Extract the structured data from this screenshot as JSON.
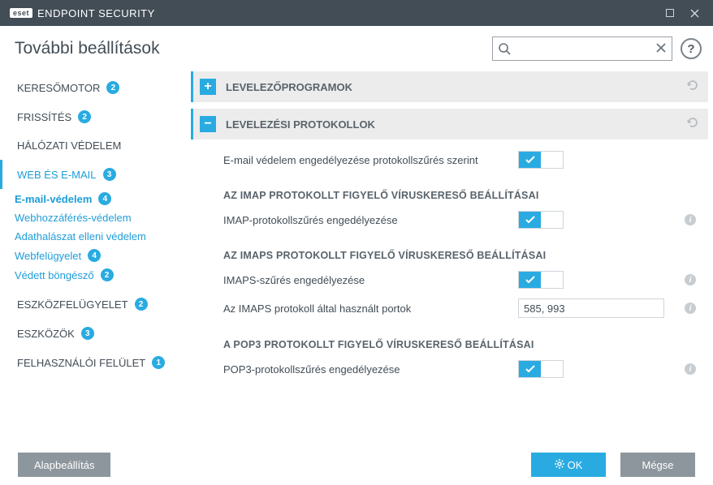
{
  "titlebar": {
    "brand_badge": "eset",
    "brand_text": "ENDPOINT SECURITY"
  },
  "header": {
    "title": "További beállítások",
    "search_placeholder": "",
    "help_label": "?"
  },
  "sidebar": {
    "items": [
      {
        "label": "KERESŐMOTOR",
        "badge": "2"
      },
      {
        "label": "FRISSÍTÉS",
        "badge": "2"
      },
      {
        "label": "HÁLÓZATI VÉDELEM",
        "badge": ""
      },
      {
        "label": "WEB ÉS E-MAIL",
        "badge": "3"
      },
      {
        "label": "ESZKÖZFELÜGYELET",
        "badge": "2"
      },
      {
        "label": "ESZKÖZÖK",
        "badge": "3"
      },
      {
        "label": "FELHASZNÁLÓI FELÜLET",
        "badge": "1"
      }
    ],
    "subitems": [
      {
        "label": "E-mail-védelem",
        "badge": "4"
      },
      {
        "label": "Webhozzáférés-védelem",
        "badge": ""
      },
      {
        "label": "Adathalászat elleni védelem",
        "badge": ""
      },
      {
        "label": "Webfelügyelet",
        "badge": "4"
      },
      {
        "label": "Védett böngésző",
        "badge": "2"
      }
    ]
  },
  "sections": {
    "mail_clients": {
      "title": "LEVELEZŐPROGRAMOK"
    },
    "mail_protocols": {
      "title": "LEVELEZÉSI PROTOKOLLOK",
      "enable_label": "E-mail védelem engedélyezése protokollszűrés szerint",
      "imap_head": "AZ IMAP PROTOKOLLT FIGYELŐ VÍRUSKERESŐ BEÁLLÍTÁSAI",
      "imap_enable": "IMAP-protokollszűrés engedélyezése",
      "imaps_head": "AZ IMAPS PROTOKOLLT FIGYELŐ VÍRUSKERESŐ BEÁLLÍTÁSAI",
      "imaps_enable": "IMAPS-szűrés engedélyezése",
      "imaps_ports_label": "Az IMAPS protokoll által használt portok",
      "imaps_ports_value": "585, 993",
      "pop3_head": "A POP3 PROTOKOLLT FIGYELŐ VÍRUSKERESŐ BEÁLLÍTÁSAI",
      "pop3_enable": "POP3-protokollszűrés engedélyezése"
    }
  },
  "footer": {
    "default_label": "Alapbeállítás",
    "ok_label": "OK",
    "cancel_label": "Mégse"
  }
}
